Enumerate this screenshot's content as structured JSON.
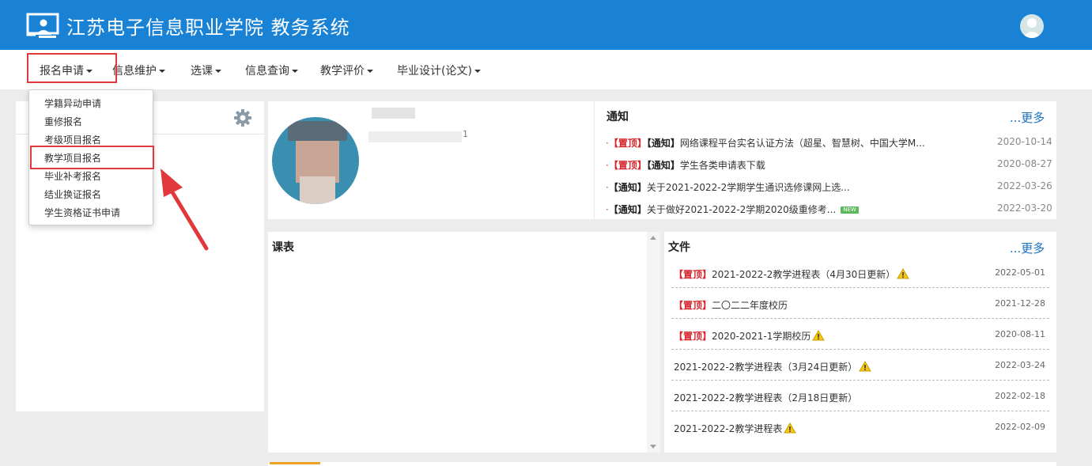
{
  "header": {
    "title": "江苏电子信息职业学院 教务系统"
  },
  "nav": [
    {
      "label": "报名申请"
    },
    {
      "label": "信息维护"
    },
    {
      "label": "选课"
    },
    {
      "label": "信息查询"
    },
    {
      "label": "教学评价"
    },
    {
      "label": "毕业设计(论文)"
    }
  ],
  "dropdown": {
    "items": [
      "学籍异动申请",
      "重修报名",
      "考级项目报名",
      "教学项目报名",
      "毕业补考报名",
      "结业换证报名",
      "学生资格证书申请"
    ],
    "highlighted": "教学项目报名"
  },
  "profile": {
    "suffix": "1"
  },
  "notice": {
    "title": "通知",
    "more": "...更多",
    "rows": [
      {
        "top": "【置顶】",
        "tag": "【通知】",
        "text": "网络课程平台实名认证方法（超星、智慧树、中国大学M...",
        "date": "2020-10-14"
      },
      {
        "top": "【置顶】",
        "tag": "【通知】",
        "text": "学生各类申请表下载",
        "date": "2020-08-27"
      },
      {
        "top": "",
        "tag": "【通知】",
        "text": "关于2021-2022-2学期学生通识选修课网上选...",
        "date": "2022-03-26"
      },
      {
        "top": "",
        "tag": "【通知】",
        "text": "关于做好2021-2022-2学期2020级重修考...",
        "date": "2022-03-20",
        "badge": "NEW"
      }
    ]
  },
  "schedule": {
    "title": "课表"
  },
  "files": {
    "title": "文件",
    "more": "...更多",
    "rows": [
      {
        "top": "【置顶】",
        "text": "2021-2022-2教学进程表（4月30日更新）",
        "date": "2022-05-01",
        "warn": true
      },
      {
        "top": "【置顶】",
        "text": "二〇二二年度校历",
        "date": "2021-12-28",
        "warn": false
      },
      {
        "top": "【置顶】",
        "text": "2020-2021-1学期校历",
        "date": "2020-08-11",
        "warn": true
      },
      {
        "top": "",
        "text": "2021-2022-2教学进程表（3月24日更新）",
        "date": "2022-03-24",
        "warn": true
      },
      {
        "top": "",
        "text": "2021-2022-2教学进程表（2月18日更新）",
        "date": "2022-02-18",
        "warn": false
      },
      {
        "top": "",
        "text": "2021-2022-2教学进程表",
        "date": "2022-02-09",
        "warn": true
      }
    ]
  },
  "colors": {
    "header": "#1a82d4",
    "highlight_box": "#e0383b",
    "link": "#1a6fbf",
    "pinned": "#d5262d"
  },
  "icons": [
    "monitor-person-logo-icon",
    "user-avatar-icon",
    "gear-icon",
    "caret-down-icon",
    "warning-icon",
    "red-arrow-annotation"
  ]
}
